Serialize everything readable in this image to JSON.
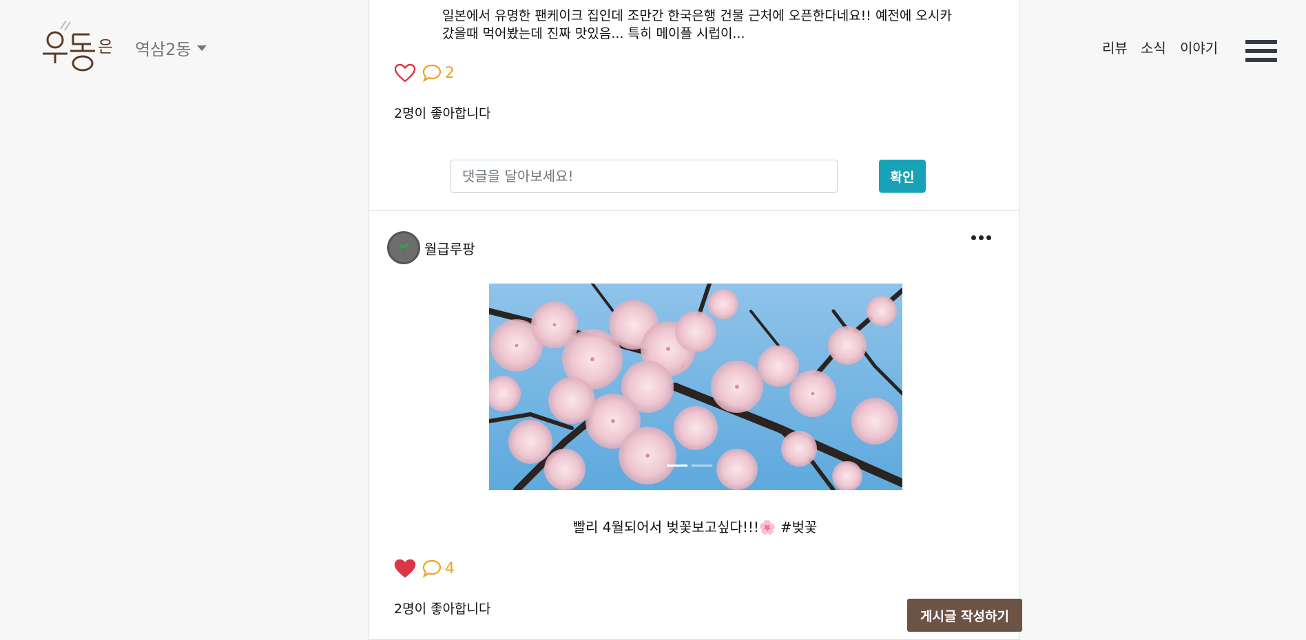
{
  "header": {
    "logo_text": "우동",
    "logo_suffix": "은",
    "region": "역삼2동",
    "nav": [
      "리뷰",
      "소식",
      "이야기"
    ]
  },
  "posts": [
    {
      "text": "일본에서 유명한 팬케이크 집인데 조만간 한국은행 건물 근처에 오픈한다네요!! 예전에 오시카 갔을때 먹어봤는데 진짜 맛있음... 특히 메이플 시럽이...",
      "liked": false,
      "comment_count": "2",
      "likes_text": "2명이 좋아합니다",
      "comment_placeholder": "댓글을 달아보세요!",
      "confirm_label": "확인"
    },
    {
      "author": "월급루팡",
      "caption": "빨리 4월되어서 벚꽃보고싶다!!!🌸",
      "hashtag": "#벚꽃",
      "liked": true,
      "comment_count": "4",
      "likes_text": "2명이 좋아합니다",
      "image_subject": "cherry blossoms",
      "slides": 2,
      "active_slide": 1
    }
  ],
  "write_button": "게시글 작성하기",
  "colors": {
    "accent_teal": "#17a2b8",
    "heart_red": "#dc3545",
    "comment_orange": "#f0a020",
    "write_brown": "#6b5346",
    "logo_brown": "#5a3a28"
  }
}
